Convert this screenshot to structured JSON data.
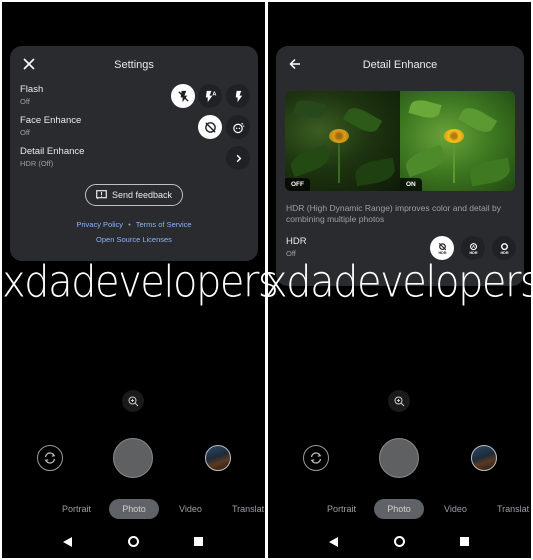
{
  "watermark": "xdadevelopers",
  "settings_screen": {
    "title": "Settings",
    "close_icon": "close-icon",
    "rows": [
      {
        "label": "Flash",
        "value": "Off",
        "options": [
          "flash-off-icon",
          "flash-auto-icon",
          "flash-on-icon"
        ],
        "selected": 0
      },
      {
        "label": "Face Enhance",
        "value": "Off",
        "options": [
          "face-enhance-off-icon",
          "face-enhance-on-icon"
        ],
        "selected": 0
      },
      {
        "label": "Detail Enhance",
        "value": "HDR (Off)",
        "action": "chevron-right-icon"
      }
    ],
    "send_feedback": "Send feedback",
    "privacy_policy": "Privacy Policy",
    "separator": "•",
    "terms": "Terms of Service",
    "licenses": "Open Source Licenses"
  },
  "detail_screen": {
    "title": "Detail Enhance",
    "back_icon": "arrow-back-icon",
    "compare": {
      "off_label": "OFF",
      "on_label": "ON"
    },
    "description": "HDR (High Dynamic Range) improves color and detail by combining multiple photos",
    "hdr": {
      "label": "HDR",
      "value": "Off",
      "options": [
        {
          "icon": "hdr-off-icon",
          "text": "HDR"
        },
        {
          "icon": "hdr-auto-icon",
          "text": "HDR"
        },
        {
          "icon": "hdr-on-icon",
          "text": "HDR"
        }
      ],
      "selected": 0
    }
  },
  "camera": {
    "modes": [
      "Portrait",
      "Photo",
      "Video",
      "Translat"
    ],
    "active_mode": "Photo"
  }
}
